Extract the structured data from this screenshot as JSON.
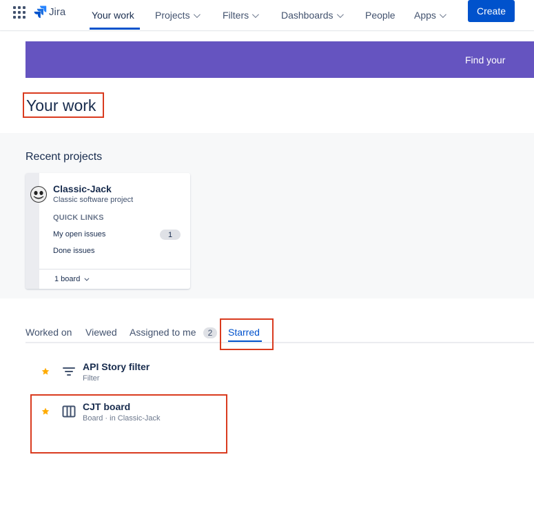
{
  "nav": {
    "logo_text": "Jira",
    "items": [
      {
        "label": "Your work"
      },
      {
        "label": "Projects"
      },
      {
        "label": "Filters"
      },
      {
        "label": "Dashboards"
      },
      {
        "label": "People"
      },
      {
        "label": "Apps"
      }
    ],
    "create_label": "Create"
  },
  "banner": {
    "text": "Find your"
  },
  "page": {
    "title": "Your work"
  },
  "recent": {
    "heading": "Recent projects",
    "project": {
      "name": "Classic-Jack",
      "type": "Classic software project",
      "quick_links_label": "QUICK LINKS",
      "links": [
        {
          "label": "My open issues",
          "count": "1"
        },
        {
          "label": "Done issues"
        }
      ],
      "boards_label": "1 board"
    }
  },
  "tabs": {
    "items": [
      {
        "label": "Worked on"
      },
      {
        "label": "Viewed"
      },
      {
        "label": "Assigned to me",
        "count": "2"
      },
      {
        "label": "Starred"
      }
    ],
    "active": "Starred"
  },
  "starred": [
    {
      "title": "API Story filter",
      "meta": "Filter",
      "icon": "filter-icon"
    },
    {
      "title": "CJT board",
      "meta": "Board  ·  in Classic-Jack",
      "icon": "board-icon"
    }
  ],
  "colors": {
    "brand": "#0052cc",
    "banner": "#6554c0",
    "highlight_box": "#d93a1e",
    "star": "#ffab00"
  }
}
